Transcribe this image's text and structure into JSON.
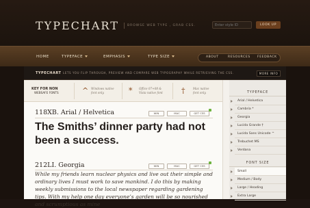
{
  "header": {
    "logo": "TYPECHART",
    "tagline": "BROWSE WEB TYPE , GRAB CSS.",
    "search_placeholder": "Enter style ID",
    "lookup_label": "LOOK UP"
  },
  "nav": {
    "items": [
      "HOME",
      "TYPEFACE",
      "EMPHASIS",
      "TYPE SIZE"
    ],
    "right_items": [
      "ABOUT",
      "RESOURCES",
      "FEEDBACK"
    ]
  },
  "info": {
    "brand": "TYPECHART",
    "text": "LETS YOU FLIP THROUGH, PREVIEW AND COMPARE WEB TYPOGRAPHY WHILE RETRIEVING THE CSS.",
    "more_info": "MORE INFO"
  },
  "key": {
    "title_line1": "KEY FOR NON",
    "title_line2": "WEBSAFE FONTS",
    "entries": [
      {
        "symbol": "^",
        "line1": "Windows native",
        "line2": "font only."
      },
      {
        "symbol": "*",
        "line1": "Office 07+08 &",
        "line2": "Vista native font"
      },
      {
        "symbol": "†",
        "line1": "Mac native",
        "line2": "font only."
      }
    ]
  },
  "fonts": [
    {
      "title": "118XB. Arial / Helvetica",
      "buttons": [
        "WIN",
        "MAC",
        "GET CSS"
      ],
      "sample": "The Smiths’ dinner party had not been a success."
    },
    {
      "title": "212LI. Georgia",
      "buttons": [
        "WIN",
        "MAC",
        "GET CSS"
      ],
      "sample": "While my friends learn nuclear physics and live out their simple and ordinary lives I must work to save mankind. I do this by making weekly submissions to the local newspaper regarding gardening tips. With my help one day everyone’s garden will be so nourished and scrumptious as mine"
    }
  ],
  "sidebar": {
    "typeface_heading": "TYPEFACE",
    "typefaces": [
      "Arial / Helvetica",
      "Cambria *",
      "Georgia",
      "Lucida Grande †",
      "Lucida Sans Unicode ^",
      "Trebuchet MS",
      "Verdana"
    ],
    "fontsize_heading": "FONT SIZE",
    "sizes": [
      "Small",
      "Medium / Body",
      "Large / Heading",
      "Extra Large"
    ]
  },
  "colors": {
    "accent": "#6b3f1e",
    "nav_bg": "#4e3620",
    "page_bg": "#fbfaf7",
    "get_css_badge": "#6eb33f"
  }
}
